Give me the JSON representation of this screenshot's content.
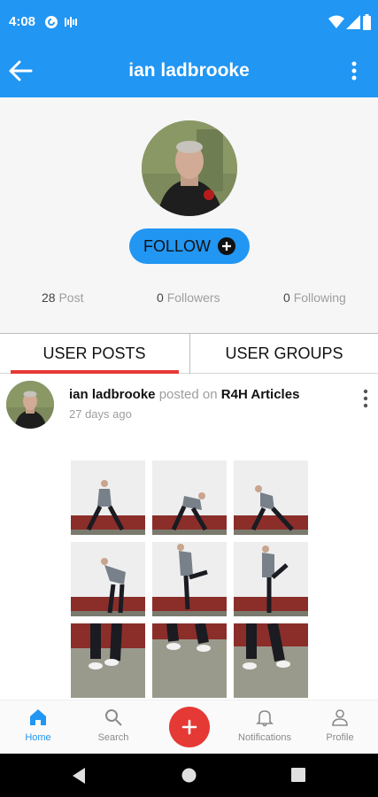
{
  "status_bar": {
    "time": "4:08",
    "icons": [
      "pocket-casts-icon",
      "sync-icon",
      "wifi-icon",
      "signal-icon",
      "battery-icon"
    ]
  },
  "app_bar": {
    "title": "ian ladbrooke",
    "back_icon": "arrow-back-icon",
    "menu_icon": "more-vert-icon"
  },
  "profile": {
    "follow_label": "FOLLOW",
    "follow_icon": "add-circle-icon",
    "stats": [
      {
        "count": "28",
        "label": "Post"
      },
      {
        "count": "0",
        "label": "Followers"
      },
      {
        "count": "0",
        "label": "Following"
      }
    ]
  },
  "tabs": [
    {
      "label": "USER POSTS",
      "active": true
    },
    {
      "label": "USER GROUPS",
      "active": false
    }
  ],
  "post": {
    "author": "ian ladbrooke",
    "posted_on_text": "posted on",
    "group": "R4H Articles",
    "time": "27 days ago",
    "image_count": 9
  },
  "bottom_nav": [
    {
      "label": "Home",
      "icon": "home-icon",
      "active": true
    },
    {
      "label": "Search",
      "icon": "search-icon",
      "active": false
    },
    {
      "label": "",
      "icon": "add-icon",
      "active": false
    },
    {
      "label": "Notifications",
      "icon": "bell-icon",
      "active": false
    },
    {
      "label": "Profile",
      "icon": "person-icon",
      "active": false
    }
  ],
  "colors": {
    "primary": "#2196f3",
    "accent_red": "#e53935",
    "profile_background": "#f6f6f6"
  }
}
